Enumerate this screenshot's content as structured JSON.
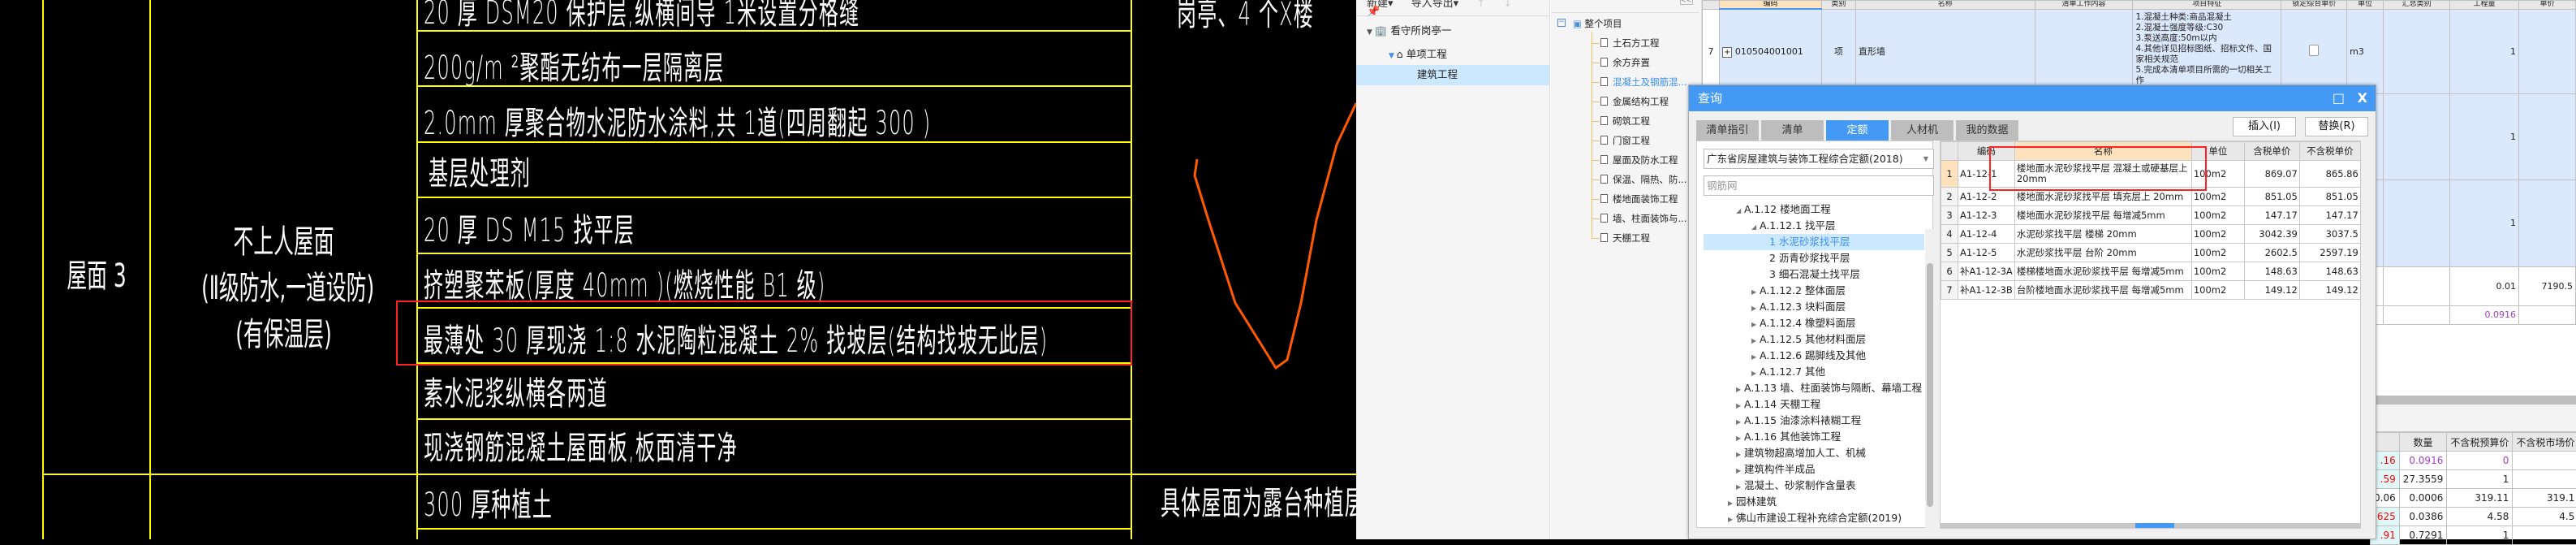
{
  "cad": {
    "rows": [
      "20 厚 DSM20  保护层,纵横间导    1米设置分格缝",
      "200g/m  ²聚酯无纺布一层隔离层",
      "2.0mm  厚聚合物水泥防水涂料,共      1道(四周翻起   300  )",
      "基层处理剂",
      "20 厚 DS  M15  找平层",
      "挤塑聚苯板(厚度     40mm   )(燃烧性能      B1 级)",
      "最薄处  30 厚现浇  1:8  水泥陶粒混凝土    2% 找坡层(结构找坡无此层)",
      "素水泥浆纵横各两道",
      "现浇钢筋混凝土屋面板,板面清干净",
      "300  厚种植土"
    ],
    "roof_name": "屋面 3",
    "roof_desc": [
      "不上人屋面",
      "(Ⅱ级防水,一道设防)",
      "(有保温层)"
    ],
    "note_top": "岗亭、4 个X楼",
    "note_bottom": "具体屋面为露台种植层",
    "highlight_color": "#ff2020",
    "annotation_color": "#ff5a00",
    "line_color": "#ffff00"
  },
  "toolbar": {
    "new": "新建▾",
    "import_export": "导入导出▾",
    "up": "↑",
    "down": "↓",
    "pin": "📌",
    "collapse": "<<"
  },
  "project_tree": {
    "root": "看守所岗亭一",
    "single": "单项工程",
    "selected": "建筑工程"
  },
  "section_tree": {
    "root": "整个项目",
    "items": [
      "土石方工程",
      "余方弃置",
      "混凝土及钢筋混...",
      "金属结构工程",
      "砌筑工程",
      "门窗工程",
      "屋面及防水工程",
      "保温、隔热、防...",
      "楼地面装饰工程",
      "墙、柱面装饰与...",
      "天棚工程"
    ],
    "active_index": 2
  },
  "bg_grid": {
    "headers": [
      "",
      "编码",
      "类别",
      "名称",
      "清单工作内容",
      "项目特征",
      "锁定综合单价",
      "单位",
      "汇总类别",
      "工程量",
      "单价"
    ],
    "row": {
      "no": "7",
      "code": "010504001001",
      "type": "项",
      "name": "直形墙",
      "features": "1.混凝土种类:商品混凝土\n2.混凝土强度等级:C30\n3.泵送高度:50m以内\n4.其他详见招标图纸、招标文件、国家相关规范\n5.完成本清单项目所需的一切相关工作",
      "unit": "m3",
      "qty": "1"
    },
    "more_qty": [
      "1",
      "0.01",
      "0.0916"
    ],
    "more_price": "7190.5"
  },
  "lower_grid": {
    "headers": [
      "",
      "数量",
      "不含税预算价",
      "不含税市场价"
    ],
    "rows": [
      [
        ".16",
        "0.0916",
        "0",
        ""
      ],
      [
        ".59",
        "27.3559",
        "1",
        ""
      ],
      [
        "0.06",
        "0.0006",
        "319.11",
        "319.1"
      ],
      [
        "625",
        "0.0386",
        "4.58",
        "4.5"
      ],
      [
        ".91",
        "0.7291",
        "1",
        ""
      ]
    ]
  },
  "dialog": {
    "title": "查询",
    "maximize": "□",
    "close": "X",
    "tabs": [
      "清单指引",
      "清单",
      "定额",
      "人材机",
      "我的数据"
    ],
    "active_tab": 2,
    "insert": "插入(I)",
    "replace": "替换(R)",
    "quota_select": "广东省房屋建筑与装饰工程综合定额(2018)",
    "search_value": "钢筋网",
    "tree": [
      {
        "label": "A.1.12 楼地面工程",
        "level": 1,
        "expanded": true
      },
      {
        "label": "A.1.12.1 找平层",
        "level": 2,
        "expanded": true
      },
      {
        "label": "1 水泥砂浆找平层",
        "level": 3,
        "selected": true
      },
      {
        "label": "2 沥青砂浆找平层",
        "level": 3
      },
      {
        "label": "3 细石混凝土找平层",
        "level": 3
      },
      {
        "label": "A.1.12.2 整体面层",
        "level": 2
      },
      {
        "label": "A.1.12.3 块料面层",
        "level": 2
      },
      {
        "label": "A.1.12.4 橡塑料面层",
        "level": 2
      },
      {
        "label": "A.1.12.5 其他材料面层",
        "level": 2
      },
      {
        "label": "A.1.12.6 踢脚线及其他",
        "level": 2
      },
      {
        "label": "A.1.12.7 其他",
        "level": 2
      },
      {
        "label": "A.1.13 墙、柱面装饰与隔断、幕墙工程",
        "level": 1
      },
      {
        "label": "A.1.14 天棚工程",
        "level": 1
      },
      {
        "label": "A.1.15 油漆涂料裱糊工程",
        "level": 1
      },
      {
        "label": "A.1.16 其他装饰工程",
        "level": 1
      },
      {
        "label": "建筑物超高增加人工、机械",
        "level": 1
      },
      {
        "label": "建筑构件半成品",
        "level": 1
      },
      {
        "label": "混凝土、砂浆制作含量表",
        "level": 1
      },
      {
        "label": "园林建筑",
        "level": 0
      },
      {
        "label": "佛山市建设工程补充综合定额(2019)",
        "level": 0
      }
    ],
    "grid_headers": [
      "",
      "编码",
      "名称",
      "单位",
      "含税单价",
      "不含税单价"
    ],
    "grid_rows": [
      [
        "1",
        "A1-12-1",
        "楼地面水泥砂浆找平层 混凝土或硬基层上 20mm",
        "100m2",
        "869.07",
        "865.86"
      ],
      [
        "2",
        "A1-12-2",
        "楼地面水泥砂浆找平层 填充层上 20mm",
        "100m2",
        "851.05",
        "851.05"
      ],
      [
        "3",
        "A1-12-3",
        "楼地面水泥砂浆找平层 每增减5mm",
        "100m2",
        "147.17",
        "147.17"
      ],
      [
        "4",
        "A1-12-4",
        "水泥砂浆找平层 楼梯 20mm",
        "100m2",
        "3042.39",
        "3037.5"
      ],
      [
        "5",
        "A1-12-5",
        "水泥砂浆找平层 台阶 20mm",
        "100m2",
        "2602.5",
        "2597.19"
      ],
      [
        "6",
        "补A1-12-3A",
        "楼梯楼地面水泥砂浆找平层 每增减5mm",
        "100m2",
        "148.63",
        "148.63"
      ],
      [
        "7",
        "补A1-12-3B",
        "台阶楼地面水泥砂浆找平层 每增减5mm",
        "100m2",
        "149.12",
        "149.12"
      ]
    ],
    "accent": "#4499f5"
  }
}
